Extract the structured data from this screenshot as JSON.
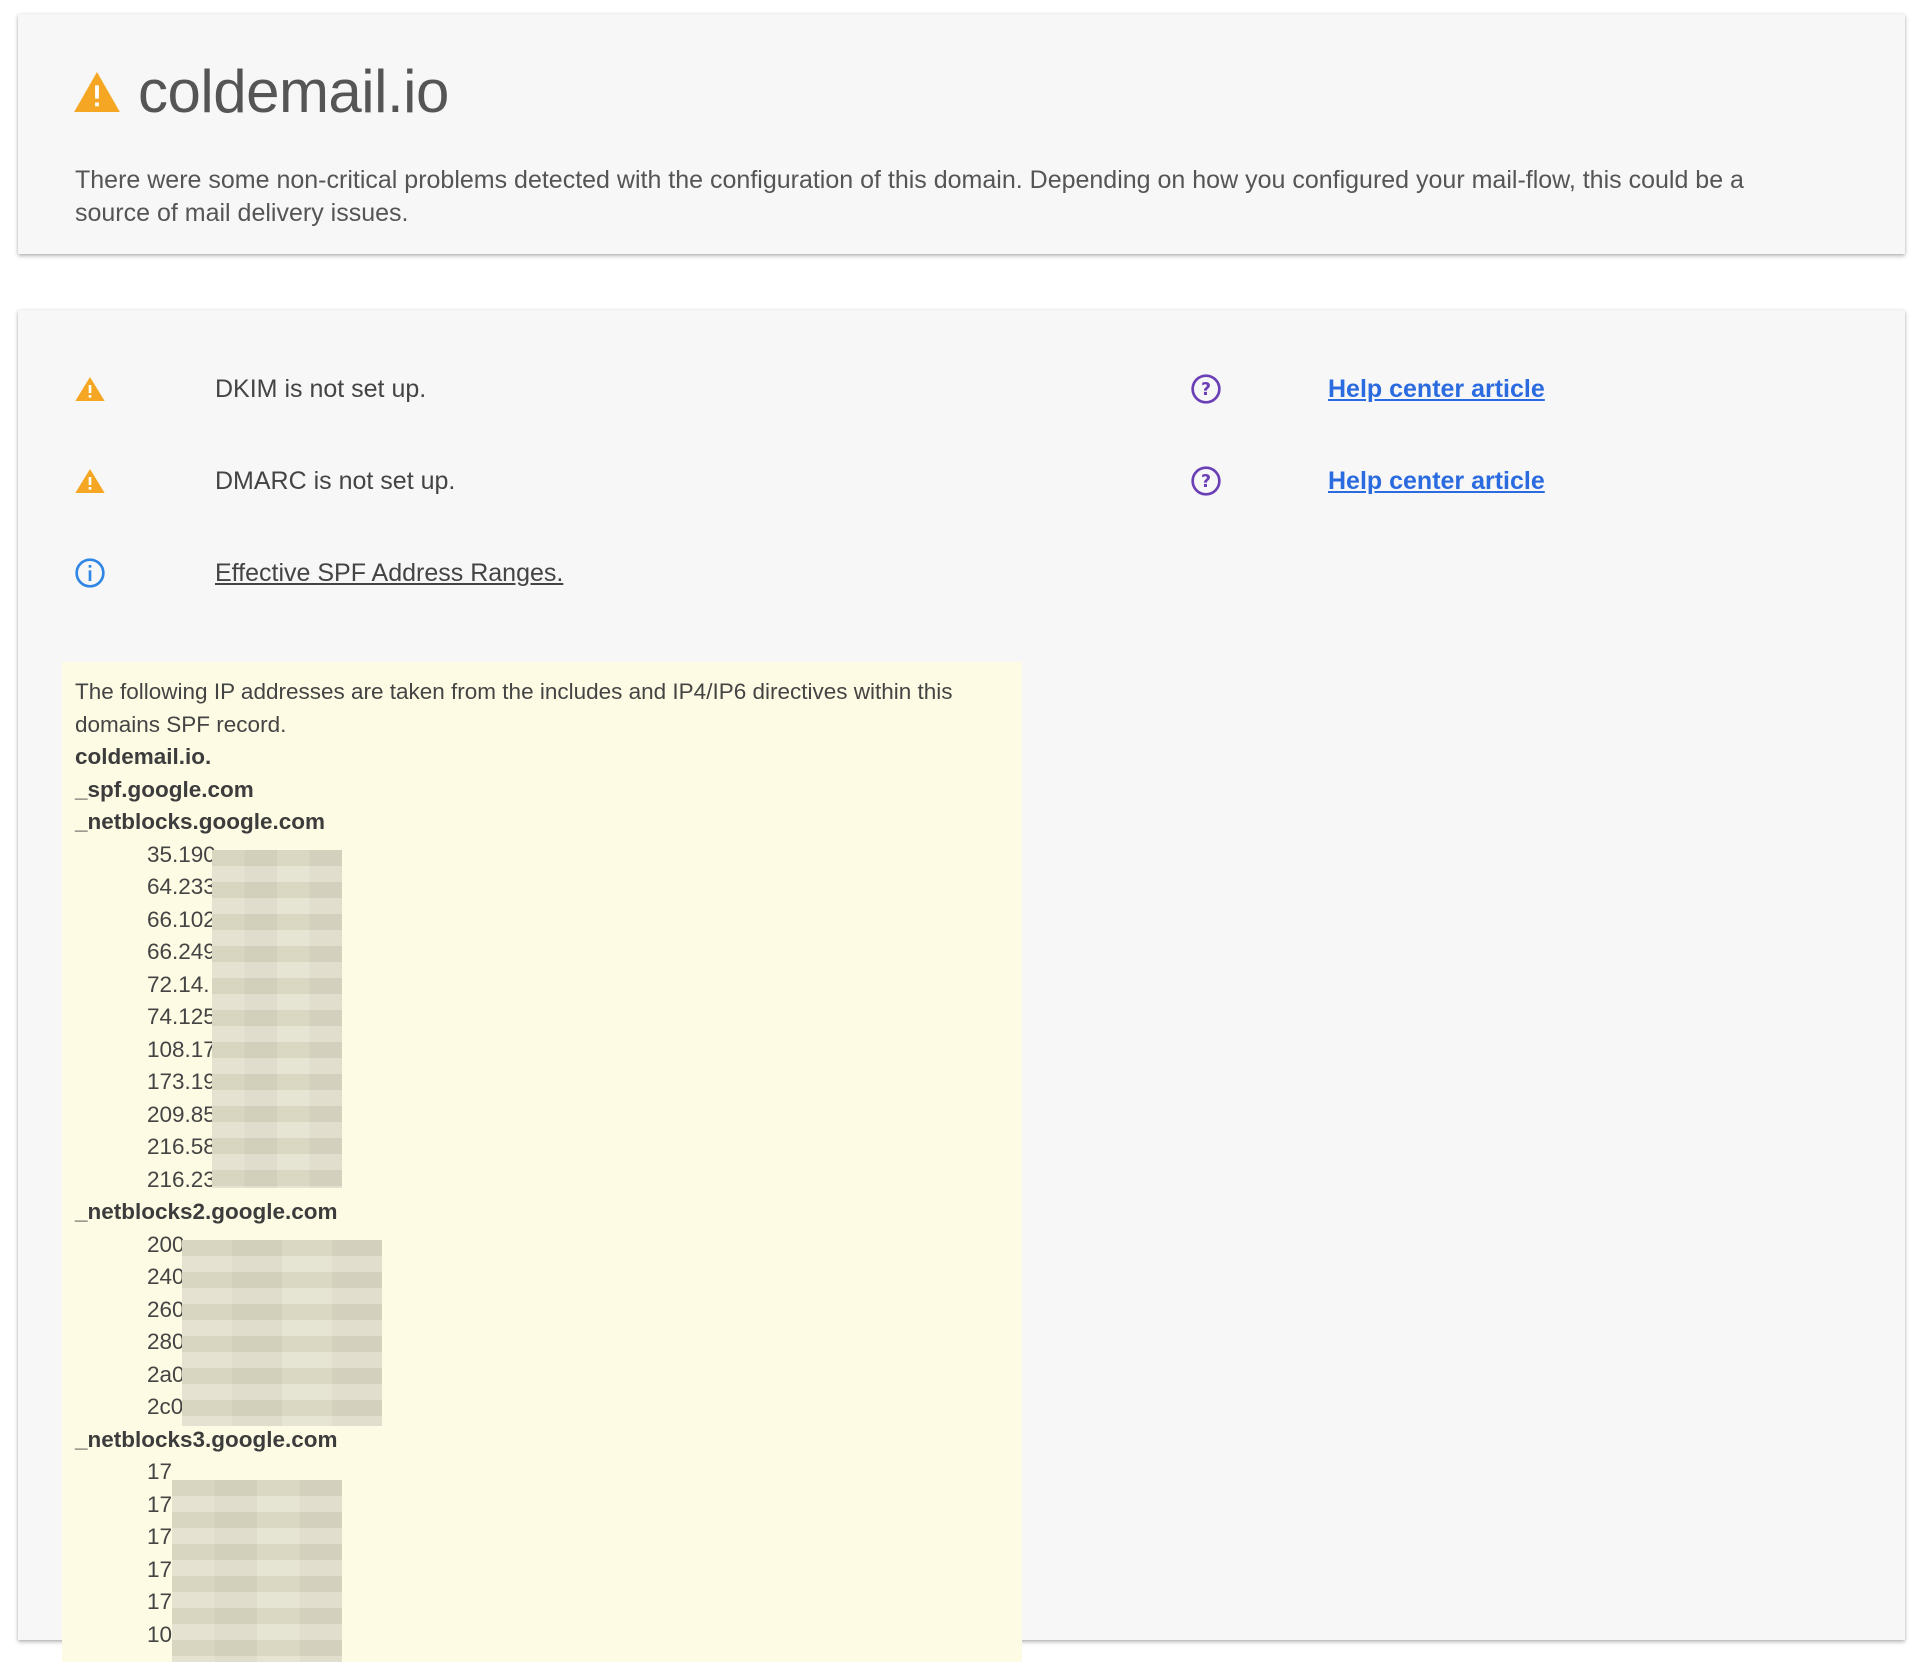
{
  "summary": {
    "domain": "coldemail.io",
    "message": "There were some non-critical problems detected with the configuration of this domain. Depending on how you configured your mail-flow, this could be a source of mail delivery issues."
  },
  "issues": [
    {
      "status": "warning",
      "text": "DKIM is not set up.",
      "help_link": "Help center article"
    },
    {
      "status": "warning",
      "text": "DMARC is not set up.",
      "help_link": "Help center article"
    },
    {
      "status": "info",
      "text": "Effective SPF Address Ranges."
    }
  ],
  "spf": {
    "intro": "The following IP addresses are taken from the includes and IP4/IP6 directives within this domains SPF record.",
    "lines": [
      {
        "type": "host",
        "text": "coldemail.io."
      },
      {
        "type": "host",
        "text": "_spf.google.com"
      },
      {
        "type": "host",
        "text": "_netblocks.google.com"
      },
      {
        "type": "ip",
        "text": "35.190"
      },
      {
        "type": "ip",
        "text": "64.233"
      },
      {
        "type": "ip",
        "text": "66.102"
      },
      {
        "type": "ip",
        "text": "66.249"
      },
      {
        "type": "ip",
        "text": "72.14."
      },
      {
        "type": "ip",
        "text": "74.125"
      },
      {
        "type": "ip",
        "text": "108.17"
      },
      {
        "type": "ip",
        "text": "173.19"
      },
      {
        "type": "ip",
        "text": "209.85"
      },
      {
        "type": "ip",
        "text": "216.58"
      },
      {
        "type": "ip",
        "text": "216.23"
      },
      {
        "type": "host",
        "text": "_netblocks2.google.com"
      },
      {
        "type": "ip",
        "text": "200"
      },
      {
        "type": "ip",
        "text": "240"
      },
      {
        "type": "ip",
        "text": "260"
      },
      {
        "type": "ip",
        "text": "280"
      },
      {
        "type": "ip",
        "text": "2a0"
      },
      {
        "type": "ip",
        "text": "2c0"
      },
      {
        "type": "host",
        "text": "_netblocks3.google.com"
      },
      {
        "type": "ip",
        "text": "17"
      },
      {
        "type": "ip",
        "text": "17"
      },
      {
        "type": "ip",
        "text": "17"
      },
      {
        "type": "ip",
        "text": "17"
      },
      {
        "type": "ip",
        "text": "17"
      },
      {
        "type": "ip",
        "text": "10"
      }
    ]
  },
  "colors": {
    "warning": "#f5a623",
    "info": "#2f86e5",
    "help": "#6b3fb5",
    "link": "#2b6be0",
    "spf_background": "#fefbe4"
  }
}
